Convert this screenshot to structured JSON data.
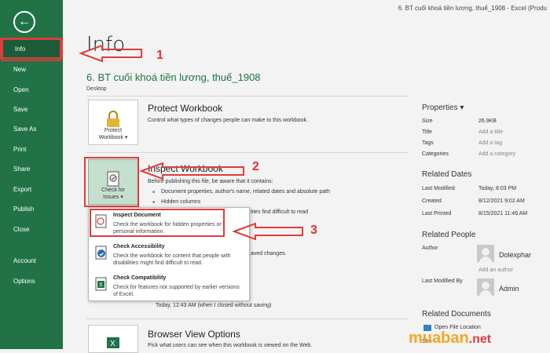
{
  "window": {
    "title": "6. BT cuối khoá tiền lương, thuế_1908 - Excel (Produ"
  },
  "sidebar": {
    "items": [
      {
        "label": "Info"
      },
      {
        "label": "New"
      },
      {
        "label": "Open"
      },
      {
        "label": "Save"
      },
      {
        "label": "Save As"
      },
      {
        "label": "Print"
      },
      {
        "label": "Share"
      },
      {
        "label": "Export"
      },
      {
        "label": "Publish"
      },
      {
        "label": "Close"
      },
      {
        "label": "Account"
      },
      {
        "label": "Options"
      }
    ]
  },
  "main": {
    "heading": "Info",
    "doc_title": "6. BT cuối khoá tiền lương, thuế_1908",
    "doc_location": "Desktop",
    "protect": {
      "tile_label_1": "Protect",
      "tile_label_2": "Workbook",
      "title": "Protect Workbook",
      "desc": "Control what types of changes people can make to this workbook."
    },
    "inspect": {
      "tile_label_1": "Check for",
      "tile_label_2": "Issues",
      "title": "Inspect Workbook",
      "desc": "Before publishing this file, be aware that it contains:",
      "bullets": [
        "Document properties, author's name, related dates and absolute path",
        "Hidden columns"
      ],
      "partial_1": "ities find difficult to read",
      "partial_2": "aved changes.",
      "partial_3": "Today, 12:43 AM (when I closed without saving)"
    },
    "browser": {
      "title": "Browser View Options",
      "desc": "Pick what users can see when this workbook is viewed on the Web."
    }
  },
  "dropdown": {
    "items": [
      {
        "title": "Inspect Document",
        "desc": "Check the workbook for hidden properties or personal information."
      },
      {
        "title": "Check Accessibility",
        "desc": "Check the workbook for content that people with disabilities might find difficult to read."
      },
      {
        "title": "Check Compatibility",
        "desc": "Check for features not supported by earlier versions of Excel."
      }
    ]
  },
  "properties": {
    "heading": "Properties",
    "rows": [
      {
        "label": "Size",
        "value": "26.9KB"
      },
      {
        "label": "Title",
        "value": "Add a title"
      },
      {
        "label": "Tags",
        "value": "Add a tag"
      },
      {
        "label": "Categories",
        "value": "Add a category"
      }
    ]
  },
  "related_dates": {
    "heading": "Related Dates",
    "rows": [
      {
        "label": "Last Modified",
        "value": "Today, 8:03 PM"
      },
      {
        "label": "Created",
        "value": "8/12/2021 9:02 AM"
      },
      {
        "label": "Last Printed",
        "value": "8/15/2021 11:46 AM"
      }
    ]
  },
  "related_people": {
    "heading": "Related People",
    "author_label": "Author",
    "author_name": "Dolexphar",
    "add_author": "Add an author",
    "last_modified_label": "Last Modified By",
    "last_modified_name": "Admin"
  },
  "related_documents": {
    "heading": "Related Documents",
    "open_location": "Open File Location",
    "show": "Sho"
  },
  "annotations": [
    "1",
    "2",
    "3"
  ],
  "watermark": {
    "main": "muaban",
    "suffix": ".net"
  }
}
